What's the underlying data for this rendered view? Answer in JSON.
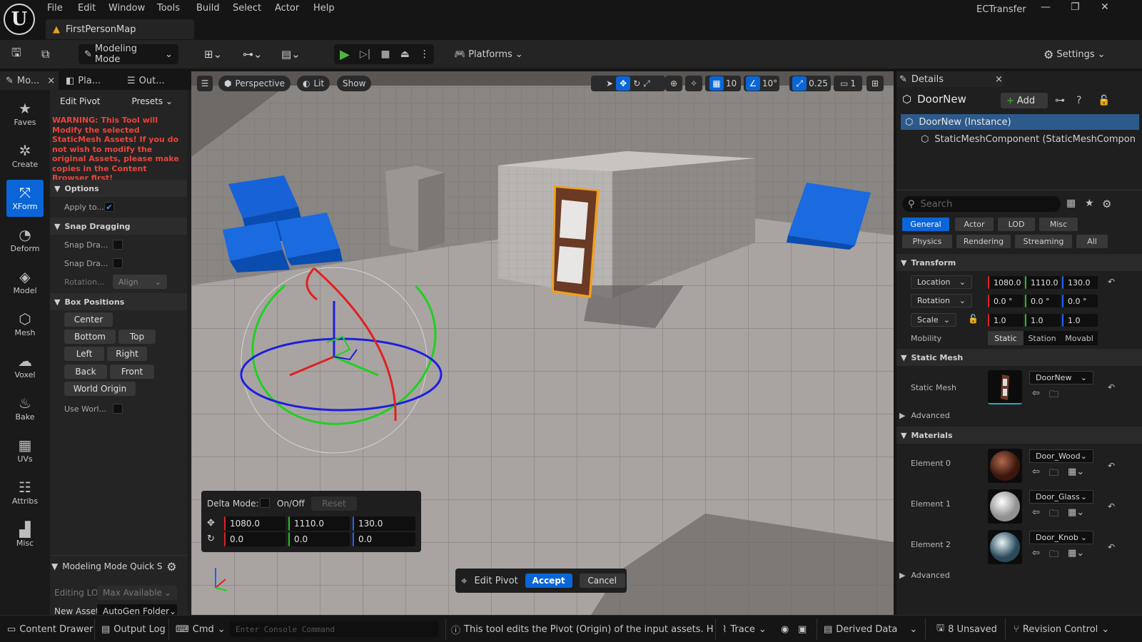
{
  "menu": [
    "File",
    "Edit",
    "Window",
    "Tools",
    "Build",
    "Select",
    "Actor",
    "Help"
  ],
  "app_title": "ECTransfer",
  "map_tab": "FirstPersonMap",
  "toolbar": {
    "mode": "Modeling Mode",
    "platforms": "Platforms",
    "settings": "Settings"
  },
  "left_tabs": [
    "Mo...",
    "Pla...",
    "Out..."
  ],
  "modes": [
    "Faves",
    "Create",
    "XForm",
    "Deform",
    "Model",
    "Mesh",
    "Voxel",
    "Bake",
    "UVs",
    "Attribs",
    "Misc"
  ],
  "tool": {
    "name": "Edit Pivot",
    "presets": "Presets",
    "warning": "WARNING: This Tool will Modify the selected StaticMesh Assets! If you do not wish to modify the original Assets, please make copies in the Content Browser first!",
    "options_header": "Options",
    "apply_to": "Apply to...",
    "snap_header": "Snap Dragging",
    "snap1": "Snap Dra...",
    "snap2": "Snap Dra...",
    "rotation": "Rotation...",
    "rotation_value": "Align",
    "box_header": "Box Positions",
    "buttons": {
      "center": "Center",
      "bottom": "Bottom",
      "top": "Top",
      "left": "Left",
      "right": "Right",
      "back": "Back",
      "front": "Front",
      "world": "World Origin"
    },
    "use_world": "Use Worl..."
  },
  "quick": {
    "title": "Modeling Mode Quick Set",
    "editing_label": "Editing LOD",
    "editing_value": "Max Available",
    "new_asset_label": "New Asset",
    "new_asset_value": "AutoGen Folder"
  },
  "viewport": {
    "perspective": "Perspective",
    "lit": "Lit",
    "show": "Show",
    "grid": "10",
    "angle": "10°",
    "scale": "0.25",
    "camera": "1"
  },
  "delta": {
    "label": "Delta Mode:",
    "toggle": "On/Off",
    "reset": "Reset",
    "loc": [
      "1080.0",
      "1110.0",
      "130.0"
    ],
    "rot": [
      "0.0",
      "0.0",
      "0.0"
    ]
  },
  "pivot_bar": {
    "label": "Edit Pivot",
    "accept": "Accept",
    "cancel": "Cancel"
  },
  "details": {
    "tab": "Details",
    "actor": "DoorNew",
    "add": "Add",
    "tree": [
      "DoorNew (Instance)",
      "StaticMeshComponent (StaticMeshCompon"
    ],
    "search": "Search",
    "cats1": [
      "General",
      "Actor",
      "LOD",
      "Misc"
    ],
    "cats2": [
      "Physics",
      "Rendering",
      "Streaming",
      "All"
    ],
    "transform": "Transform",
    "location": "Location",
    "rotation": "Rotation",
    "scale": "Scale",
    "loc": [
      "1080.0",
      "1110.0",
      "130.0"
    ],
    "rot": [
      "0.0 °",
      "0.0 °",
      "0.0 °"
    ],
    "scl": [
      "1.0",
      "1.0",
      "1.0"
    ],
    "mobility": "Mobility",
    "mob": [
      "Static",
      "Station",
      "Movabl"
    ],
    "static_mesh_header": "Static Mesh",
    "static_mesh_label": "Static Mesh",
    "static_mesh_value": "DoorNew",
    "advanced": "Advanced",
    "materials": "Materials",
    "elements": [
      {
        "label": "Element 0",
        "value": "Door_Wood"
      },
      {
        "label": "Element 1",
        "value": "Door_Glass"
      },
      {
        "label": "Element 2",
        "value": "Door_Knob"
      }
    ],
    "advanced2": "Advanced"
  },
  "status": {
    "content": "Content Drawer",
    "output": "Output Log",
    "cmd": "Cmd",
    "console_placeholder": "Enter Console Command",
    "hint": "This tool edits the Pivot (Origin) of the input assets. Hold Ctr",
    "trace": "Trace",
    "derived": "Derived Data",
    "unsaved": "8 Unsaved",
    "revision": "Revision Control"
  }
}
